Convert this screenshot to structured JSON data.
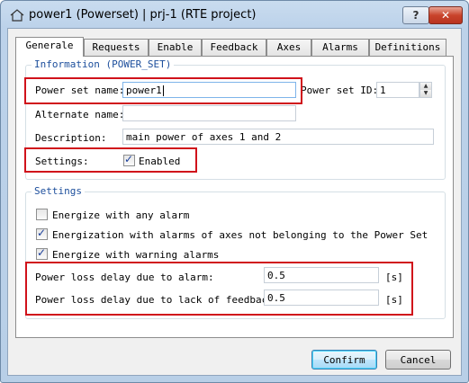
{
  "window": {
    "title": "power1 (Powerset) | prj-1 (RTE project)",
    "help_label": "?",
    "close_label": "✕"
  },
  "tabs": [
    {
      "label": "Generale",
      "active": true
    },
    {
      "label": "Requests"
    },
    {
      "label": "Enable"
    },
    {
      "label": "Feedback"
    },
    {
      "label": "Axes"
    },
    {
      "label": "Alarms"
    },
    {
      "label": "Definitions"
    }
  ],
  "information": {
    "title": "Information (POWER_SET)",
    "power_set_name_label": "Power set name:",
    "power_set_name_value": "power1",
    "power_set_id_label": "Power set ID:",
    "power_set_id_value": "1",
    "alternate_name_label": "Alternate name:",
    "alternate_name_value": "",
    "description_label": "Description:",
    "description_value": "main power of axes 1 and 2",
    "settings_label": "Settings:",
    "enabled_label": "Enabled",
    "enabled_checked": true
  },
  "settings": {
    "title": "Settings",
    "energize_any_alarm_label": "Energize with any alarm",
    "energize_any_alarm_checked": false,
    "energization_other_axes_label": "Energization with alarms of axes not belonging to the Power Set",
    "energization_other_axes_checked": true,
    "energize_warning_label": "Energize with warning alarms",
    "energize_warning_checked": true,
    "loss_alarm_label": "Power loss delay due to alarm:",
    "loss_alarm_value": "0.5",
    "loss_alarm_unit": "[s]",
    "loss_feedback_label": "Power loss delay due to lack of feedback:",
    "loss_feedback_value": "0.5",
    "loss_feedback_unit": "[s]"
  },
  "buttons": {
    "confirm": "Confirm",
    "cancel": "Cancel"
  },
  "colors": {
    "highlight": "#d0121b",
    "group_title": "#1c4e9c",
    "check": "#1a3e9a"
  }
}
